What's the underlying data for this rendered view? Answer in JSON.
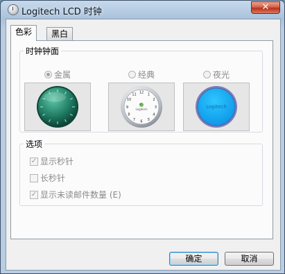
{
  "window": {
    "title": "Logitech LCD 时钟",
    "close_label": "✕"
  },
  "tabs": [
    {
      "label": "色彩"
    },
    {
      "label": "黑白"
    }
  ],
  "clock_faces": {
    "title": "时钟钟面",
    "options": [
      {
        "label": "金属",
        "selected": true
      },
      {
        "label": "经典",
        "selected": false
      },
      {
        "label": "夜光",
        "selected": false
      }
    ],
    "classic_logo": "Logitech",
    "night_logo": "Logitech"
  },
  "options_group": {
    "title": "选项",
    "items": [
      {
        "label": "显示秒针",
        "checked": true
      },
      {
        "label": "长秒针",
        "checked": false
      },
      {
        "label": "显示未读邮件数量 (E)",
        "checked": true
      }
    ]
  },
  "buttons": {
    "ok": "确定",
    "cancel": "取消"
  }
}
